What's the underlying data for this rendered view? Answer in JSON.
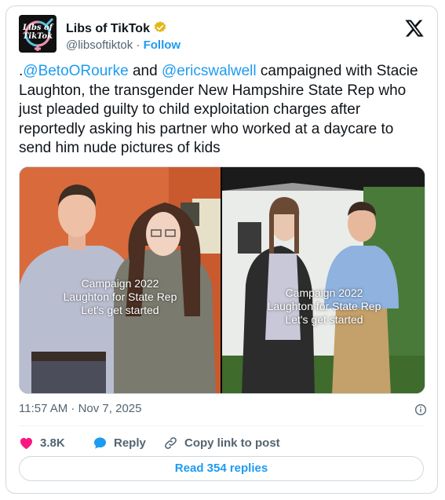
{
  "author": {
    "name": "Libs of TikTok",
    "handle": "@libsoftiktok",
    "separator": "·",
    "follow_label": "Follow",
    "avatar_text_line1": "Libs of",
    "avatar_text_line2": "TikTok"
  },
  "tweet": {
    "prefix": ".",
    "mention1": "@BetoORourke",
    "and": " and ",
    "mention2": "@ericswalwell",
    "body": " campaigned with Stacie Laughton, the transgender New Hampshire State Rep who just pleaded guilty to child exploitation charges after reportedly asking his partner who worked at a daycare to send him nude pictures of kids"
  },
  "media": {
    "left_caption": [
      "Campaign 2022",
      "Laughton for State Rep",
      "Let's get started"
    ],
    "right_caption": [
      "Campaign 2022",
      "Laughton for State Rep",
      "Let's get started"
    ]
  },
  "timestamp": "11:57 AM · Nov 7, 2025",
  "actions": {
    "like_count": "3.8K",
    "reply_label": "Reply",
    "copy_label": "Copy link to post"
  },
  "read_replies_label": "Read 354 replies",
  "colors": {
    "accent": "#1d9bf0",
    "like": "#f91880",
    "muted": "#536471",
    "verified": "#e2b719"
  },
  "icons": [
    "verified-badge-icon",
    "x-logo-icon",
    "info-icon",
    "heart-icon",
    "reply-bubble-icon",
    "link-icon"
  ]
}
